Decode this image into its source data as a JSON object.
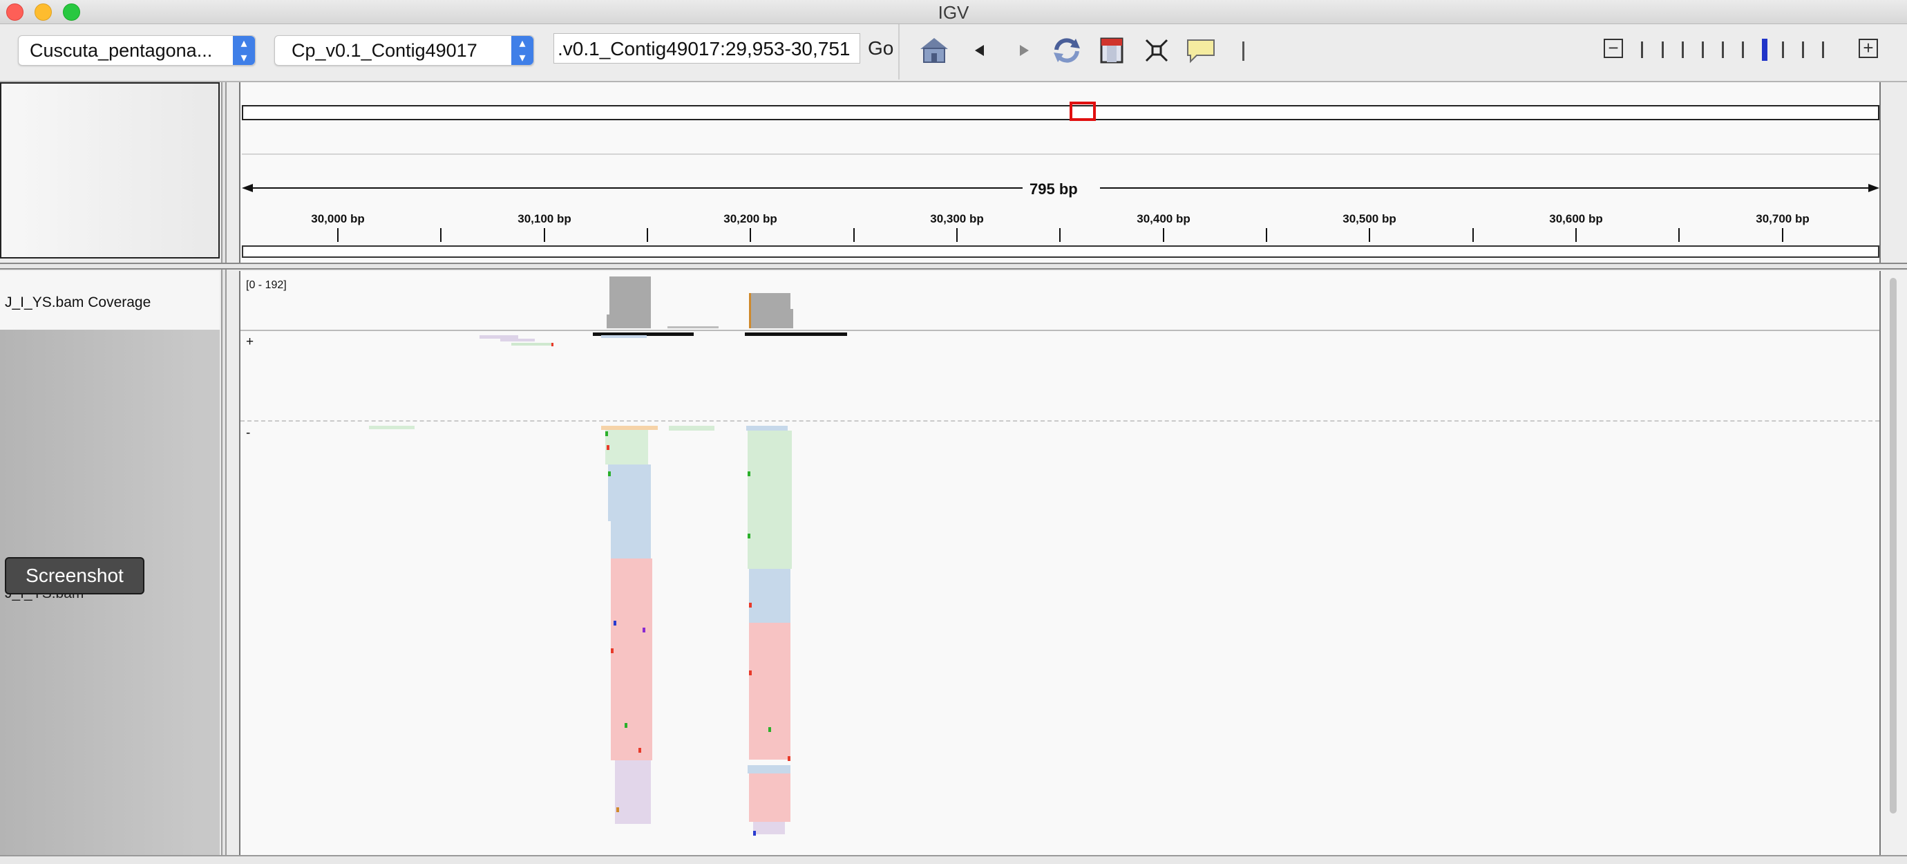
{
  "window": {
    "title": "IGV"
  },
  "toolbar": {
    "genome": "Cuscuta_pentagona...",
    "chromosome": "Cp_v0.1_Contig49017",
    "locus": ".v0.1_Contig49017:29,953-30,751",
    "go_label": "Go",
    "icons": [
      "home-icon",
      "back-arrow-icon",
      "forward-arrow-icon",
      "refresh-icon",
      "region-of-interest-icon",
      "resize-to-window-icon",
      "popup-info-icon"
    ]
  },
  "ruler": {
    "span_label": "795 bp",
    "tick_labels": [
      "30,000 bp",
      "30,100 bp",
      "30,200 bp",
      "30,300 bp",
      "30,400 bp",
      "30,500 bp",
      "30,600 bp",
      "30,700 bp"
    ]
  },
  "tracks": {
    "coverage_name": "J_I_YS.bam Coverage",
    "coverage_range": "[0 - 192]",
    "alignment_name": "J_I_YS.bam",
    "plus_strand": "+",
    "minus_strand": "-"
  },
  "overlay": {
    "screenshot_button": "Screenshot"
  },
  "colors": {
    "accent": "#3f7fe8",
    "roi_red": "#e01010",
    "coverage": "#a9a9a9"
  }
}
